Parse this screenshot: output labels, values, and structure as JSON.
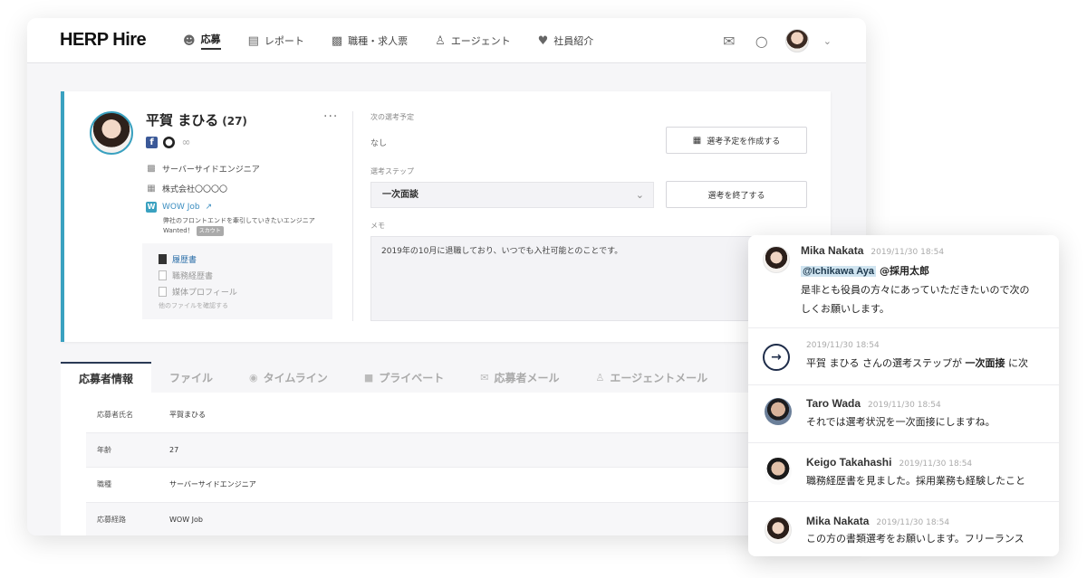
{
  "app": {
    "logo": "HERP Hire"
  },
  "nav": {
    "items": [
      {
        "label": "応募",
        "icon": "users-icon",
        "active": true
      },
      {
        "label": "レポート",
        "icon": "bar-chart-icon",
        "active": false
      },
      {
        "label": "職種・求人票",
        "icon": "briefcase-icon",
        "active": false
      },
      {
        "label": "エージェント",
        "icon": "agent-icon",
        "active": false
      },
      {
        "label": "社員紹介",
        "icon": "handshake-icon",
        "active": false
      }
    ]
  },
  "candidate": {
    "name": "平賀 まひる",
    "age": "(27)",
    "position": "サーバーサイドエンジニア",
    "company": "株式会社〇〇〇〇",
    "source": "WOW Job",
    "source_desc_line1": "弊社のフロントエンドを牽引していきたいエンジニア",
    "source_desc_line2": "Wanted！",
    "scout_badge": "スカウト",
    "files": [
      "履歴書",
      "職務経歴書",
      "媒体プロフィール"
    ],
    "files_more": "他のファイルを確認する"
  },
  "schedule": {
    "label": "次の選考予定",
    "value": "なし",
    "create_button": "選考予定を作成する"
  },
  "step": {
    "label": "選考ステップ",
    "value": "一次面談",
    "end_button": "選考を終了する"
  },
  "memo": {
    "label": "メモ",
    "text": "2019年の10月に退職しており、いつでも入社可能とのことです。"
  },
  "tabs": [
    {
      "label": "応募者情報",
      "active": true
    },
    {
      "label": "ファイル",
      "active": false
    },
    {
      "label": "タイムライン",
      "active": false
    },
    {
      "label": "プライベート",
      "active": false
    },
    {
      "label": "応募者メール",
      "active": false
    },
    {
      "label": "エージェントメール",
      "active": false
    }
  ],
  "details": [
    {
      "key": "応募者氏名",
      "value": "平賀まひる"
    },
    {
      "key": "年齢",
      "value": "27"
    },
    {
      "key": "職種",
      "value": "サーバーサイドエンジニア"
    },
    {
      "key": "応募経路",
      "value": "WOW Job"
    }
  ],
  "chat": {
    "messages": [
      {
        "author": "Mika Nakata",
        "time": "2019/11/30 18:54",
        "mention1": "@Ichikawa Aya",
        "mention2": "@採用太郎",
        "line1": "是非とも役員の方々にあっていただきたいので次の",
        "line2": "しくお願いします。"
      },
      {
        "time": "2019/11/30 18:54",
        "text_pre": "平賀 まひる さんの選考ステップが ",
        "text_bold": "一次面接",
        "text_post": " に次"
      },
      {
        "author": "Taro Wada",
        "time": "2019/11/30 18:54",
        "text": "それでは選考状況を一次面接にしますね。"
      },
      {
        "author": "Keigo Takahashi",
        "time": "2019/11/30 18:54",
        "text": "職務経歴書を見ました。採用業務も経験したこと"
      },
      {
        "author": "Mika Nakata",
        "time": "2019/11/30 18:54",
        "text": "この方の書類選考をお願いします。フリーランス"
      }
    ]
  },
  "colors": {
    "accent": "#3aa1c0",
    "navy": "#1f2d4a",
    "link": "#2a6ea8"
  }
}
